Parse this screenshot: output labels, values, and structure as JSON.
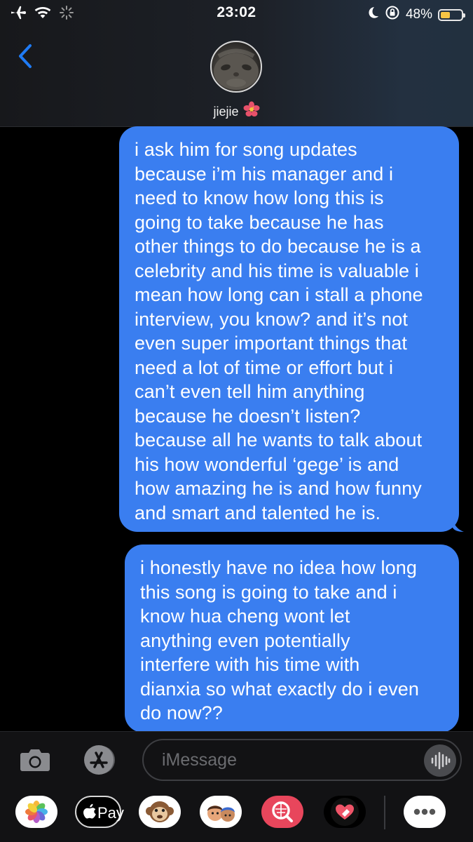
{
  "status_bar": {
    "time": "23:02",
    "battery_percent": "48%",
    "battery_level": 0.48,
    "icons": [
      "airplane-icon",
      "wifi-icon",
      "loading-spinner-icon",
      "moon-icon",
      "orientation-lock-icon",
      "battery-icon"
    ]
  },
  "header": {
    "contact_name": "jiejie",
    "contact_emoji": "hibiscus-icon",
    "back_icon": "chevron-left-icon"
  },
  "messages": [
    {
      "direction": "outgoing",
      "lines": [
        "i ask him for song updates",
        "because i’m his manager and i",
        "need to know how long this is",
        "going to take because he has",
        "other things to do because he is a",
        "celebrity and his time is valuable i",
        "mean how long can i stall a phone",
        "interview, you know? and it’s not",
        "even super important things that",
        "need a lot of time or effort but i",
        "can’t even tell him anything",
        "because he doesn’t listen?",
        "because all he wants to talk about",
        "his how wonderful ‘gege’ is and",
        "how amazing he is and how funny",
        "and smart and talented he is."
      ]
    },
    {
      "direction": "outgoing",
      "lines": [
        "i honestly have no idea how long",
        "this song is going to take and i",
        "know hua cheng wont let",
        "anything even potentially",
        "interfere with his time with",
        "dianxia so what exactly do i even",
        "do now??"
      ]
    }
  ],
  "input_bar": {
    "placeholder": "iMessage",
    "icons": [
      "camera-icon",
      "app-store-icon",
      "audio-waveform-icon"
    ]
  },
  "app_drawer": {
    "apple_pay_label": "Pay",
    "apps": [
      "photos-icon",
      "apple-pay-icon",
      "monkey-memoji-icon",
      "memoji-stickers-icon",
      "search-images-icon",
      "digital-touch-icon",
      "more-apps-icon"
    ]
  },
  "colors": {
    "bubble_blue": "#3a7ef0",
    "ios_blue": "#1f7bf5",
    "background": "#000000",
    "battery_yellow": "#f6c544"
  }
}
